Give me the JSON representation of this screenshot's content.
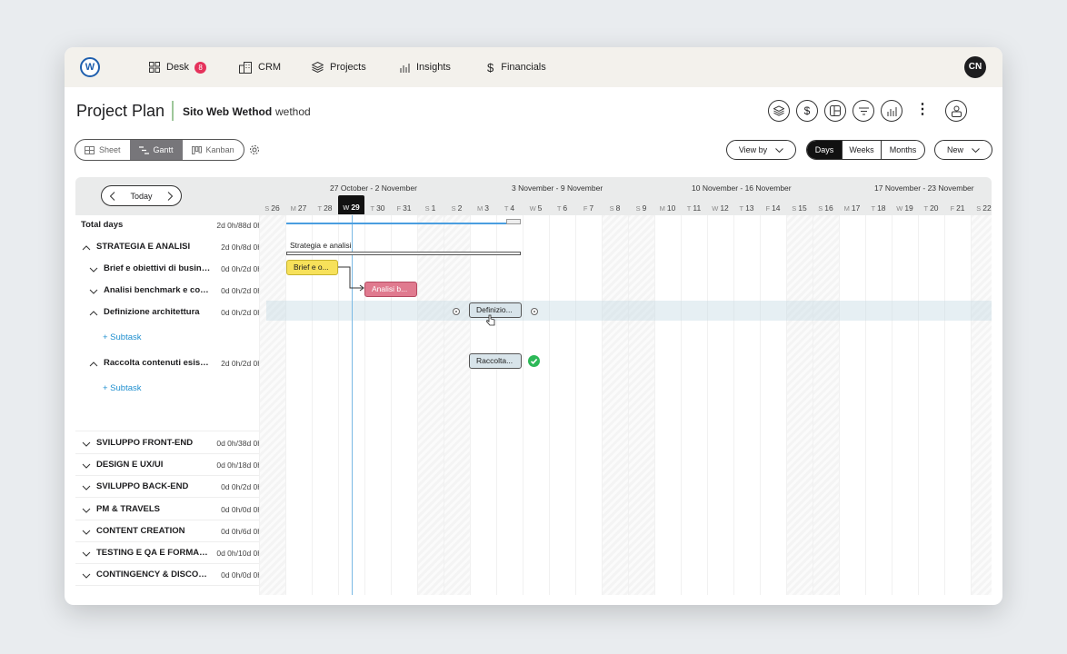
{
  "nav": {
    "logo": "W",
    "items": [
      {
        "label": "Desk",
        "badge": "8",
        "icon": "grid-icon"
      },
      {
        "label": "CRM",
        "icon": "building-icon"
      },
      {
        "label": "Projects",
        "icon": "layers-icon"
      },
      {
        "label": "Insights",
        "icon": "bar-chart-icon"
      },
      {
        "label": "Financials",
        "icon": "dollar-icon"
      }
    ],
    "avatar": "CN"
  },
  "header": {
    "title": "Project Plan",
    "project_name": "Sito Web Wethod",
    "client": "wethod"
  },
  "toolbar": {
    "views": [
      "Sheet",
      "Gantt",
      "Kanban"
    ],
    "active_view": "Gantt",
    "view_by": "View by",
    "scales": [
      "Days",
      "Weeks",
      "Months"
    ],
    "active_scale": "Days",
    "new_label": "New"
  },
  "gantt": {
    "today_label": "Today",
    "weeks": [
      "27 October - 2 November",
      "3 November - 9 November",
      "10 November - 16 November",
      "17 November - 23 November"
    ],
    "days": [
      {
        "d": "S",
        "n": "26",
        "we": true
      },
      {
        "d": "M",
        "n": "27"
      },
      {
        "d": "T",
        "n": "28"
      },
      {
        "d": "W",
        "n": "29",
        "current": true
      },
      {
        "d": "T",
        "n": "30"
      },
      {
        "d": "F",
        "n": "31"
      },
      {
        "d": "S",
        "n": "1",
        "we": true
      },
      {
        "d": "S",
        "n": "2",
        "we": true
      },
      {
        "d": "M",
        "n": "3"
      },
      {
        "d": "T",
        "n": "4"
      },
      {
        "d": "W",
        "n": "5"
      },
      {
        "d": "T",
        "n": "6"
      },
      {
        "d": "F",
        "n": "7"
      },
      {
        "d": "S",
        "n": "8",
        "we": true
      },
      {
        "d": "S",
        "n": "9",
        "we": true
      },
      {
        "d": "M",
        "n": "10"
      },
      {
        "d": "T",
        "n": "11"
      },
      {
        "d": "W",
        "n": "12"
      },
      {
        "d": "T",
        "n": "13"
      },
      {
        "d": "F",
        "n": "14"
      },
      {
        "d": "S",
        "n": "15",
        "we": true
      },
      {
        "d": "S",
        "n": "16",
        "we": true
      },
      {
        "d": "M",
        "n": "17"
      },
      {
        "d": "T",
        "n": "18"
      },
      {
        "d": "W",
        "n": "19"
      },
      {
        "d": "T",
        "n": "20"
      },
      {
        "d": "F",
        "n": "21"
      },
      {
        "d": "S",
        "n": "22",
        "we": true
      }
    ],
    "total": {
      "label": "Total days",
      "duration": "2d 0h/88d 0h"
    },
    "group1": {
      "label": "STRATEGIA E ANALISI",
      "duration": "2d 0h/8d 0h",
      "bar_label": "Strategia e analisi"
    },
    "tasks": [
      {
        "label": "Brief e obiettivi di business",
        "duration": "0d 0h/2d 0h",
        "bar": "Brief e o..."
      },
      {
        "label": "Analisi benchmark e competitor",
        "duration": "0d 0h/2d 0h",
        "bar": "Analisi b..."
      },
      {
        "label": "Definizione architettura",
        "duration": "0d 0h/2d 0h",
        "bar": "Definizio..."
      },
      {
        "label": "Raccolta contenuti esistenti",
        "duration": "2d 0h/2d 0h",
        "bar": "Raccolta..."
      }
    ],
    "subtask_label": "+ Subtask",
    "groups": [
      {
        "label": "SVILUPPO FRONT-END",
        "duration": "0d 0h/38d 0h"
      },
      {
        "label": "DESIGN E UX/UI",
        "duration": "0d 0h/18d 0h"
      },
      {
        "label": "SVILUPPO BACK-END",
        "duration": "0d 0h/2d 0h"
      },
      {
        "label": "PM & TRAVELS",
        "duration": "0d 0h/0d 0h"
      },
      {
        "label": "CONTENT CREATION",
        "duration": "0d 0h/6d 0h"
      },
      {
        "label": "TESTING E QA E FORMAZIONE",
        "duration": "0d 0h/10d 0h"
      },
      {
        "label": "CONTINGENCY & DISCOUNT",
        "duration": "0d 0h/0d 0h"
      }
    ]
  },
  "colors": {
    "brief": "#f7e15a",
    "analisi": "#e07a8f",
    "definizione": "#d8e4ea",
    "accent": "#1f8fcf",
    "done": "#2cb857"
  }
}
